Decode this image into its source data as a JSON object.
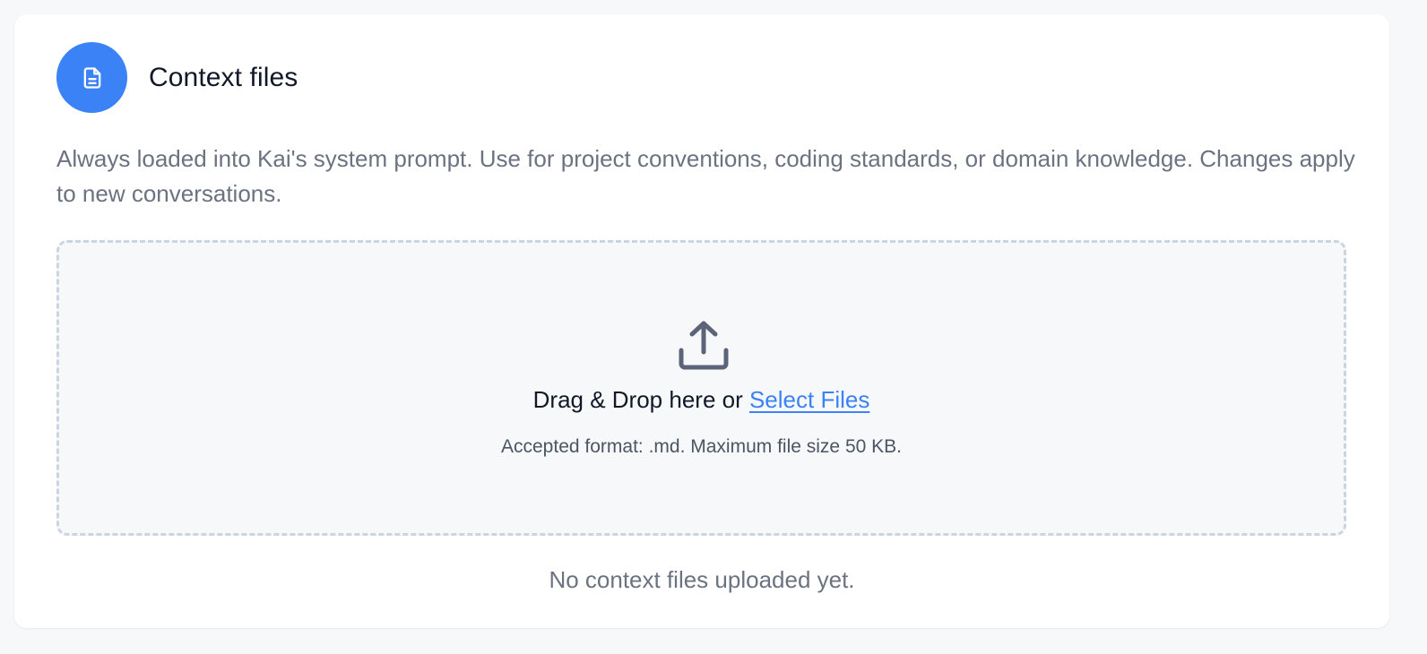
{
  "section": {
    "title": "Context files",
    "icon": "document-icon",
    "accent_color": "#3b82f6",
    "description": "Always loaded into Kai's system prompt. Use for project conventions, coding standards, or domain knowledge. Changes apply to new conversations."
  },
  "dropzone": {
    "icon": "upload-icon",
    "prompt_text": "Drag & Drop here or ",
    "link_text": "Select Files",
    "format_note": "Accepted format: .md. Maximum file size 50 KB."
  },
  "empty_state": {
    "message": "No context files uploaded yet."
  }
}
